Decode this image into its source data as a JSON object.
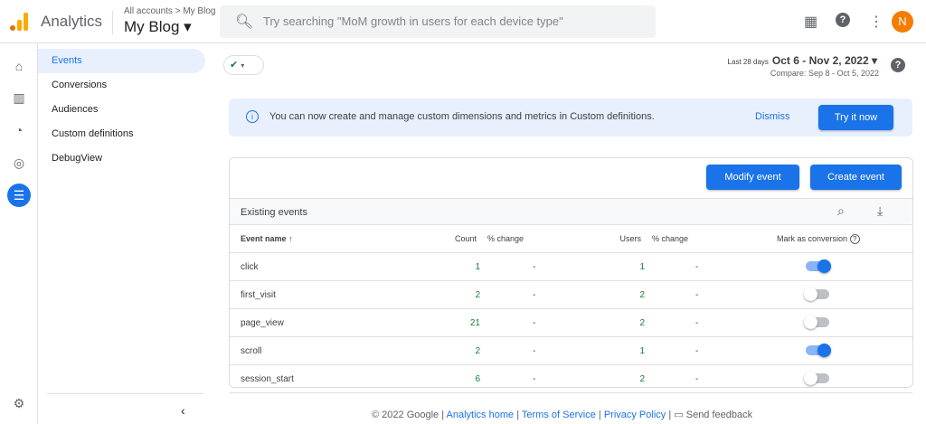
{
  "header": {
    "app": "Analytics",
    "breadcrumb": "All accounts > My Blog",
    "property": "My Blog ▾",
    "search_placeholder": "Try searching \"MoM growth in users for each device type\"",
    "avatar": "N"
  },
  "nav": [
    "Events",
    "Conversions",
    "Audiences",
    "Custom definitions",
    "DebugView"
  ],
  "date": {
    "label": "Last 28 days",
    "range": "Oct 6 - Nov 2, 2022 ▾",
    "compare": "Compare: Sep 8 - Oct 5, 2022"
  },
  "banner": {
    "text": "You can now create and manage custom dimensions and metrics in Custom definitions.",
    "dismiss": "Dismiss",
    "try": "Try it now"
  },
  "buttons": {
    "modify": "Modify event",
    "create": "Create event"
  },
  "table": {
    "title": "Existing events",
    "headers": {
      "name": "Event name ↑",
      "count": "Count",
      "count_change": "% change",
      "users": "Users",
      "users_change": "% change",
      "conversion": "Mark as conversion"
    },
    "rows": [
      {
        "name": "click",
        "count": "1",
        "cchg": "-",
        "users": "1",
        "uchg": "-",
        "conversion": true
      },
      {
        "name": "first_visit",
        "count": "2",
        "cchg": "-",
        "users": "2",
        "uchg": "-",
        "conversion": false
      },
      {
        "name": "page_view",
        "count": "21",
        "cchg": "-",
        "users": "2",
        "uchg": "-",
        "conversion": false
      },
      {
        "name": "scroll",
        "count": "2",
        "cchg": "-",
        "users": "1",
        "uchg": "-",
        "conversion": true
      },
      {
        "name": "session_start",
        "count": "6",
        "cchg": "-",
        "users": "2",
        "uchg": "-",
        "conversion": false
      }
    ]
  },
  "footer": {
    "copyright": "© 2022 Google |",
    "home": "Analytics home",
    "sep1": "|",
    "terms": "Terms of Service",
    "sep2": "|",
    "privacy": "Privacy Policy",
    "sep3": "|",
    "feedback": "Send feedback"
  }
}
